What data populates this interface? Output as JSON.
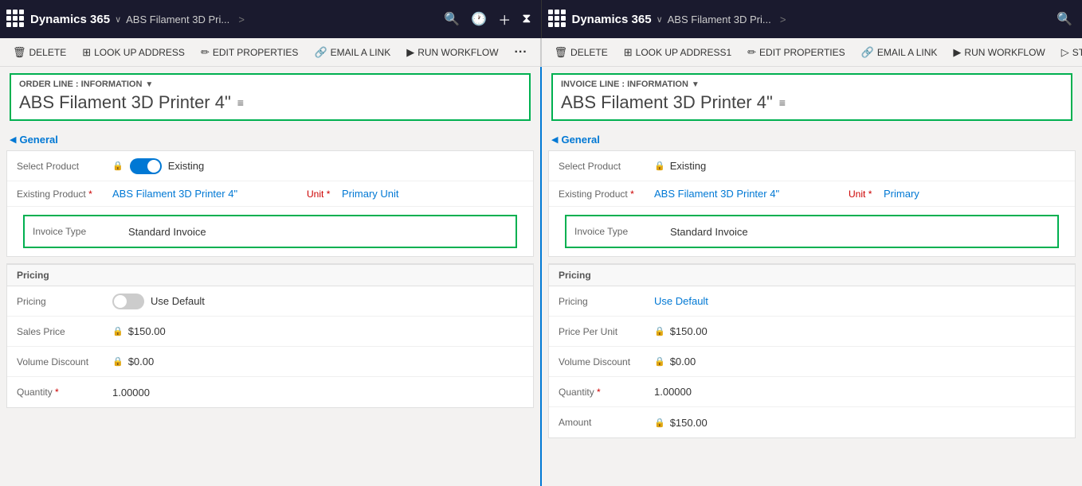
{
  "nav": {
    "left": {
      "brand": "Dynamics 365",
      "breadcrumb": "ABS Filament 3D Pri...",
      "breadcrumb_arrow": ">"
    },
    "right": {
      "brand": "Dynamics 365",
      "breadcrumb": "ABS Filament 3D Pri...",
      "breadcrumb_arrow": ">"
    }
  },
  "toolbar_left": {
    "buttons": [
      {
        "icon": "🗑",
        "label": "DELETE"
      },
      {
        "icon": "⊞",
        "label": "LOOK UP ADDRESS"
      },
      {
        "icon": "✏",
        "label": "EDIT PROPERTIES"
      },
      {
        "icon": "🔗",
        "label": "EMAIL A LINK"
      },
      {
        "icon": "▶",
        "label": "RUN WORKFLOW"
      },
      {
        "icon": "···",
        "label": ""
      }
    ]
  },
  "toolbar_right": {
    "buttons": [
      {
        "icon": "🗑",
        "label": "DELETE"
      },
      {
        "icon": "⊞",
        "label": "LOOK UP ADDRESS1"
      },
      {
        "icon": "✏",
        "label": "EDIT PROPERTIES"
      },
      {
        "icon": "🔗",
        "label": "EMAIL A LINK"
      },
      {
        "icon": "▶",
        "label": "RUN WORKFLOW"
      },
      {
        "icon": "▷",
        "label": "START DI..."
      }
    ]
  },
  "left_panel": {
    "entity_type": "ORDER LINE : INFORMATION",
    "entity_title": "ABS Filament 3D Printer 4\"",
    "section_label": "General",
    "fields": {
      "select_product_label": "Select Product",
      "select_product_toggle": "on",
      "select_product_value": "Existing",
      "existing_product_label": "Existing Product",
      "existing_product_value": "ABS Filament 3D Printer 4\"",
      "unit_label": "Unit",
      "unit_value": "Primary Unit",
      "invoice_type_label": "Invoice Type",
      "invoice_type_value": "Standard Invoice"
    },
    "pricing": {
      "section_label": "Pricing",
      "pricing_label": "Pricing",
      "pricing_toggle": "off",
      "pricing_value": "Use Default",
      "sales_price_label": "Sales Price",
      "sales_price_value": "$150.00",
      "volume_discount_label": "Volume Discount",
      "volume_discount_value": "$0.00",
      "quantity_label": "Quantity",
      "quantity_value": "1.00000"
    }
  },
  "right_panel": {
    "entity_type": "INVOICE LINE : INFORMATION",
    "entity_title": "ABS Filament 3D Printer 4\"",
    "section_label": "General",
    "fields": {
      "select_product_label": "Select Product",
      "select_product_value": "Existing",
      "existing_product_label": "Existing Product",
      "existing_product_value": "ABS Filament 3D Printer 4\"",
      "unit_label": "Unit",
      "unit_value": "Primary",
      "invoice_type_label": "Invoice Type",
      "invoice_type_value": "Standard Invoice"
    },
    "pricing": {
      "section_label": "Pricing",
      "pricing_label": "Pricing",
      "pricing_value": "Use Default",
      "price_per_unit_label": "Price Per Unit",
      "price_per_unit_value": "$150.00",
      "volume_discount_label": "Volume Discount",
      "volume_discount_value": "$0.00",
      "quantity_label": "Quantity",
      "quantity_value": "1.00000",
      "amount_label": "Amount",
      "amount_value": "$150.00"
    }
  }
}
